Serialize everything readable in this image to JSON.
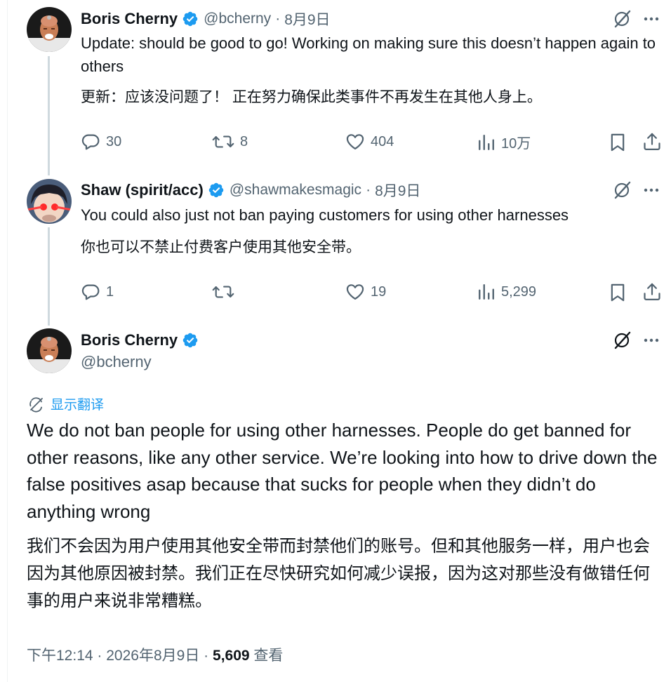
{
  "colors": {
    "accent": "#1d9bf0",
    "text_primary": "#0f1419",
    "text_secondary": "#536471",
    "thread_line": "#cfd9de",
    "verified_badge": "#1d9bf0"
  },
  "tweets": [
    {
      "display_name": "Boris Cherny",
      "verified": true,
      "handle": "@bcherny",
      "separator": "·",
      "date": "8月9日",
      "text": "Update: should be good to go! Working on making sure this doesn’t happen again to others",
      "translation": "更新：应该没问题了！ 正在努力确保此类事件不再发生在其他人身上。",
      "replies": "30",
      "reposts": "8",
      "likes": "404",
      "views": "10万"
    },
    {
      "display_name": "Shaw (spirit/acc)",
      "verified": true,
      "handle": "@shawmakesmagic",
      "separator": "·",
      "date": "8月9日",
      "text": "You could also just not ban paying customers for using other harnesses",
      "translation": "你也可以不禁止付费客户使用其他安全带。",
      "replies": "1",
      "reposts": "",
      "likes": "19",
      "views": "5,299"
    }
  ],
  "main_tweet": {
    "display_name": "Boris Cherny",
    "verified": true,
    "handle": "@bcherny",
    "show_translation": "显示翻译",
    "text": "We do not ban people for using other harnesses. People do get banned for other reasons, like any other service. We’re looking into how to drive down the false positives asap because that sucks for people when they didn’t do anything wrong",
    "translation": "我们不会因为用户使用其他安全带而封禁他们的账号。但和其他服务一样，用户也会因为其他原因被封禁。我们正在尽快研究如何减少误报，因为这对那些没有做错任何事的用户来说非常糟糕。",
    "time": "下午12:14",
    "separator": "·",
    "date": "2026年8月9日",
    "separator2": "·",
    "views": "5,609",
    "views_label": "查看"
  },
  "icons": {
    "reply": "reply-icon",
    "repost": "repost-icon",
    "like": "heart-icon",
    "views": "views-bar-chart-icon",
    "bookmark": "bookmark-icon",
    "share": "share-icon",
    "grok": "grok-icon",
    "more": "more-dots-icon",
    "translate": "translate-icon",
    "verified": "verified-badge-icon"
  }
}
